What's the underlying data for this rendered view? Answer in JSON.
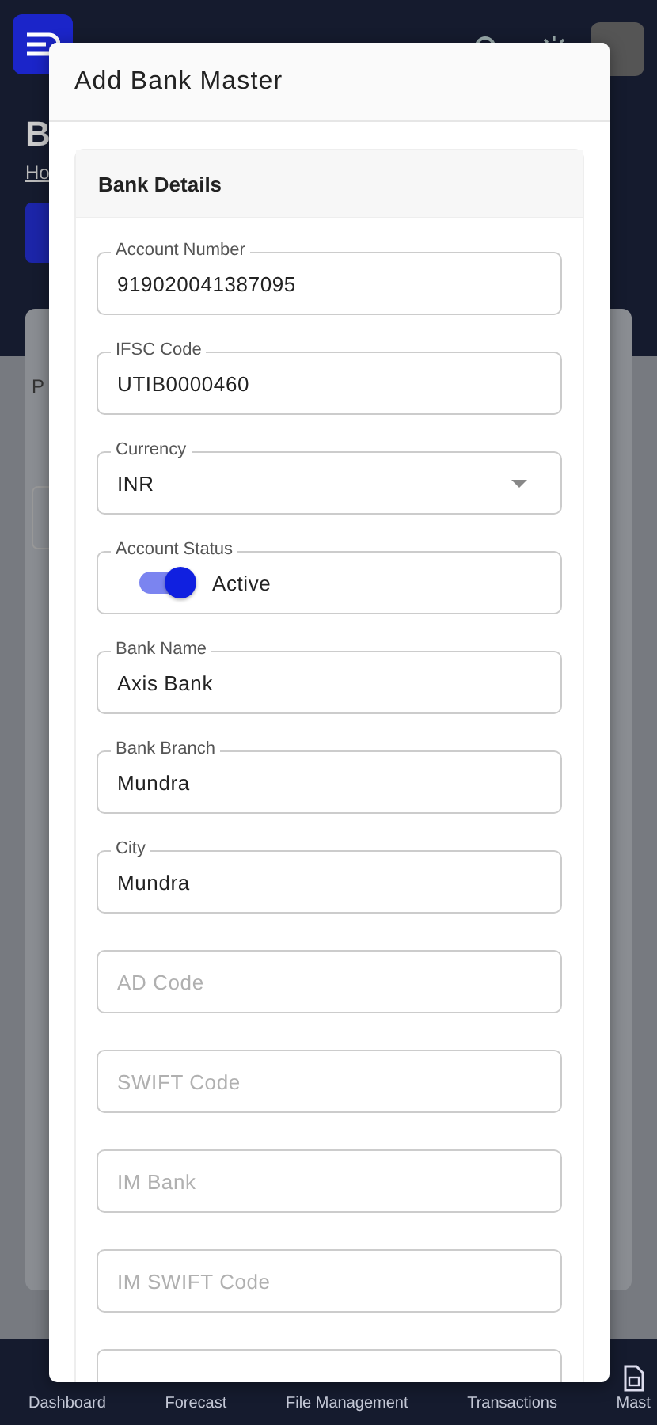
{
  "page": {
    "title": "B",
    "breadcrumb": "Ho",
    "card_label": "P"
  },
  "dialog": {
    "title": "Add Bank Master",
    "section": "Bank Details",
    "fields": [
      {
        "kind": "text",
        "label": "Account Number",
        "value": "919020041387095"
      },
      {
        "kind": "text",
        "label": "IFSC Code",
        "value": "UTIB0000460"
      },
      {
        "kind": "select",
        "label": "Currency",
        "value": "INR"
      },
      {
        "kind": "switch",
        "label": "Account Status",
        "on": true,
        "value": "Active"
      },
      {
        "kind": "text",
        "label": "Bank Name",
        "value": "Axis Bank"
      },
      {
        "kind": "text",
        "label": "Bank Branch",
        "value": "Mundra"
      },
      {
        "kind": "text",
        "label": "City",
        "value": "Mundra"
      },
      {
        "kind": "text",
        "placeholder": "AD Code"
      },
      {
        "kind": "text",
        "placeholder": "SWIFT Code"
      },
      {
        "kind": "text",
        "placeholder": "IM Bank"
      },
      {
        "kind": "text",
        "placeholder": "IM SWIFT Code"
      },
      {
        "kind": "text"
      }
    ]
  },
  "bottom_nav": [
    {
      "label": "Dashboard"
    },
    {
      "label": "Forecast"
    },
    {
      "label": "File Management"
    },
    {
      "label": "Transactions"
    },
    {
      "label": "Mast"
    }
  ]
}
